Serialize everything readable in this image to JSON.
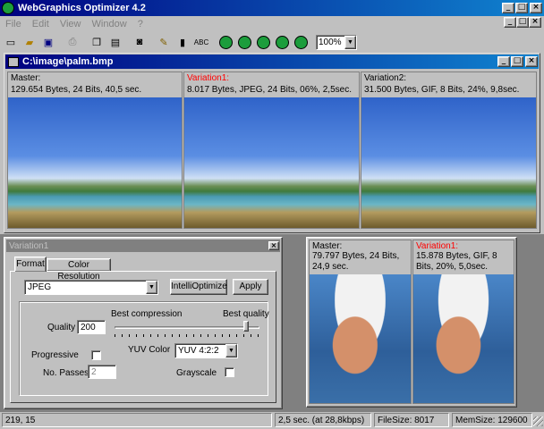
{
  "app": {
    "title": "WebGraphics Optimizer 4.2"
  },
  "menu": [
    "File",
    "Edit",
    "View",
    "Window",
    "?"
  ],
  "zoom": "100%",
  "doc": {
    "title": "C:\\image\\palm.bmp"
  },
  "top_panes": [
    {
      "label": "Master:",
      "info": "129.654 Bytes, 24 Bits, 40,5 sec.",
      "label_color": "#000000"
    },
    {
      "label": "Variation1:",
      "info": "8.017 Bytes, JPEG, 24 Bits, 06%, 2,5sec.",
      "label_color": "#ff0000"
    },
    {
      "label": "Variation2:",
      "info": "31.500 Bytes, GIF, 8 Bits, 24%, 9,8sec.",
      "label_color": "#000000"
    }
  ],
  "variation_dialog": {
    "title": "Variation1",
    "tabs": [
      "Format",
      "Color Resolution"
    ],
    "format_value": "JPEG",
    "intelli_label": "IntelliOptimize",
    "apply_label": "Apply",
    "quality_label": "Quality",
    "quality_value": "200",
    "best_compression": "Best compression",
    "best_quality": "Best quality",
    "quality_slider_fraction": 0.92,
    "progressive_label": "Progressive",
    "yuv_label": "YUV Color",
    "yuv_value": "YUV 4:2:2",
    "passes_label": "No. Passes",
    "passes_value": "2",
    "grayscale_label": "Grayscale"
  },
  "portrait": {
    "master_label": "Master:",
    "master_info": "79.797 Bytes, 24 Bits, 24,9 sec.",
    "var_label": "Variation1:",
    "var_info": "15.878 Bytes, GIF, 8 Bits, 20%, 5,0sec."
  },
  "statusbar": {
    "coords": "219, 15",
    "time": "2,5 sec. (at 28,8kbps)",
    "filesize": "FileSize: 8017",
    "memsize": "MemSize: 129600"
  }
}
